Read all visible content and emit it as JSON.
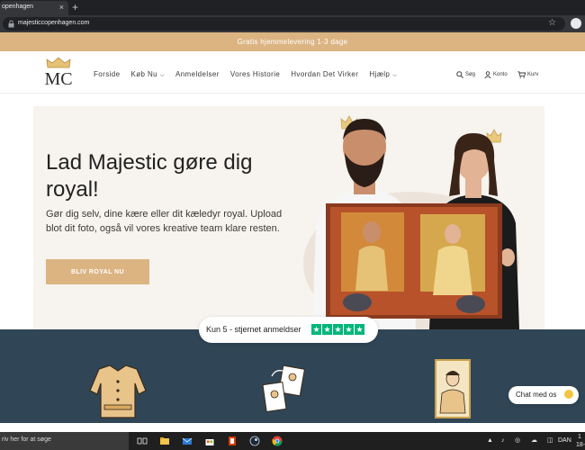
{
  "browser": {
    "tab_title": "openhagen",
    "tab_close": "×",
    "new_tab": "+",
    "url": "majesticcopenhagen.com",
    "star": "☆"
  },
  "announcement": "Gratis hjemmelevering 1-3 dage",
  "header": {
    "logo_text": "MC",
    "nav": [
      {
        "label": "Forside",
        "has_dropdown": false
      },
      {
        "label": "Køb Nu",
        "has_dropdown": true
      },
      {
        "label": "Anmeldelser",
        "has_dropdown": false
      },
      {
        "label": "Vores Historie",
        "has_dropdown": false
      },
      {
        "label": "Hvordan Det Virker",
        "has_dropdown": false
      },
      {
        "label": "Hjælp",
        "has_dropdown": true
      }
    ],
    "utility": {
      "search": "Søg",
      "account": "Konto",
      "cart": "Kurv"
    }
  },
  "hero": {
    "title": "Lad Majestic gøre dig royal!",
    "subtitle": "Gør dig selv, dine kære eller dit kæledyr royal. Upload blot dit foto, også vil vores kreative team klare resten.",
    "button": "BLIV ROYAL NU"
  },
  "reviews": {
    "text": "Kun 5 - stjernet anmeldser",
    "stars": 5
  },
  "chat": {
    "label": "Chat med os"
  },
  "taskbar": {
    "search_placeholder": "riv her for at søge",
    "language": "DAN",
    "clock_top": "1",
    "clock_bottom": "18-"
  },
  "colors": {
    "accent": "#dbb482",
    "hero_bg": "#f7f3ee",
    "dark_section": "#304656",
    "trustpilot_green": "#00b67a"
  }
}
